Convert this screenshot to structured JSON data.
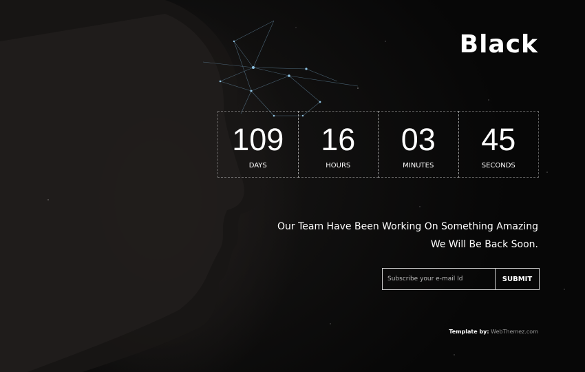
{
  "brand": {
    "logo_text": "Black"
  },
  "countdown": [
    {
      "value": "109",
      "label": "DAYS"
    },
    {
      "value": "16",
      "label": "HOURS"
    },
    {
      "value": "03",
      "label": "MINUTES"
    },
    {
      "value": "45",
      "label": "SECONDS"
    }
  ],
  "tagline": {
    "line1": "Our Team Have Been Working On Something Amazing",
    "line2": "We Will Be Back Soon."
  },
  "subscribe": {
    "placeholder": "Subscribe your e-mail Id",
    "value": "",
    "submit_label": "SUBMIT"
  },
  "footer": {
    "credit_label": "Template by:",
    "credit_link": "WebThemez.com"
  },
  "colors": {
    "background": "#070707",
    "text": "#ffffff",
    "accent_lines": "#7aa9c9"
  }
}
